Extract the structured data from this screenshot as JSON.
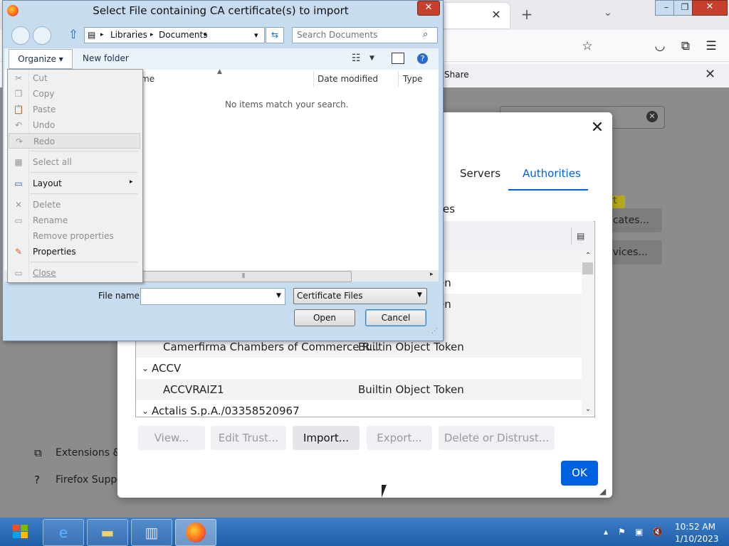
{
  "file_dialog": {
    "title": "Select File containing CA certificate(s) to import",
    "close_glyph": "✕",
    "address": {
      "path": [
        "Libraries",
        "Documents"
      ],
      "sep": "▸",
      "dropdown": "▾"
    },
    "search_placeholder": "Search Documents",
    "toolbar": {
      "organize": "Organize ▾",
      "new_folder": "New folder"
    },
    "columns": {
      "name": "me",
      "date": "Date modified",
      "type": "Type"
    },
    "empty_message": "No items match your search.",
    "file_name_label": "File name:",
    "file_name_value": "",
    "filter": "Certificate Files",
    "buttons": {
      "open": "Open",
      "cancel": "Cancel"
    }
  },
  "organize_menu": {
    "items": [
      {
        "label": "Cut",
        "icon": "✂",
        "enabled": false
      },
      {
        "label": "Copy",
        "icon": "❐",
        "enabled": false
      },
      {
        "label": "Paste",
        "icon": "📋",
        "enabled": false
      },
      {
        "label": "Undo",
        "icon": "↶",
        "enabled": false
      },
      {
        "label": "Redo",
        "icon": "↷",
        "enabled": false
      },
      {
        "label": "Select all",
        "icon": "▦",
        "enabled": false
      },
      {
        "label": "Layout",
        "icon": "▭",
        "enabled": true
      },
      {
        "label": "Delete",
        "icon": "✕",
        "enabled": false
      },
      {
        "label": "Rename",
        "icon": "▭",
        "enabled": false
      },
      {
        "label": "Remove properties",
        "icon": "",
        "enabled": false
      },
      {
        "label": "Properties",
        "icon": "✎",
        "enabled": true
      },
      {
        "label": "Close",
        "icon": "▭",
        "enabled": false
      }
    ],
    "submenu_arrow": "▸"
  },
  "cert_manager": {
    "tabs": [
      "Servers",
      "Authorities"
    ],
    "active_tab": "Authorities",
    "intro_fragment": "es",
    "close_glyph": "✕",
    "rows": [
      {
        "type": "fragment",
        "text": "en"
      },
      {
        "type": "fragment",
        "text": "en"
      },
      {
        "type": "child",
        "name": "Camerfirma Chambers of Commerce R...",
        "token": "Builtin Object Token"
      },
      {
        "type": "group",
        "name": "ACCV"
      },
      {
        "type": "child",
        "name": "ACCVRAIZ1",
        "token": "Builtin Object Token"
      },
      {
        "type": "group",
        "name": "Actalis S.p.A./03358520967"
      }
    ],
    "buttons": {
      "view": "View...",
      "edit_trust": "Edit Trust...",
      "import": "Import...",
      "export": "Export...",
      "delete": "Delete or Distrust...",
      "ok": "OK"
    }
  },
  "firefox_bg": {
    "share": "Share",
    "side_items": [
      "Extensions & T",
      "Firefox Suppor"
    ],
    "right_buttons": [
      "ficates...",
      "evices..."
    ],
    "yellow_badge": "rt"
  },
  "taskbar": {
    "time": "10:52 AM",
    "date": "1/10/2023"
  },
  "colors": {
    "accent": "#0061e0",
    "titlebar": "#c7dcef",
    "taskbar": "#2a6bb5"
  }
}
